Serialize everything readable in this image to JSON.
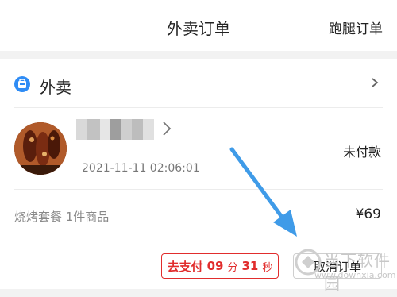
{
  "header": {
    "title": "外卖订单",
    "right_link": "跑腿订单"
  },
  "order": {
    "brand_label": "外卖",
    "brand_icon": "delivery-bag-icon",
    "time": "2021-11-11 02:06:01",
    "status": "未付款",
    "goods": "烧烤套餐 1件商品",
    "price": "¥69"
  },
  "actions": {
    "pay_label": "去支付",
    "countdown_minutes": "09",
    "minutes_unit": "分",
    "countdown_seconds": "31",
    "seconds_unit": "秒",
    "cancel_label": "取消订单"
  },
  "watermark": {
    "text": "当下软件园",
    "url": "www.downxia.com"
  },
  "colors": {
    "accent_red": "#e12d2d",
    "brand_blue": "#2f8cf5",
    "arrow_blue": "#3f9be8"
  }
}
